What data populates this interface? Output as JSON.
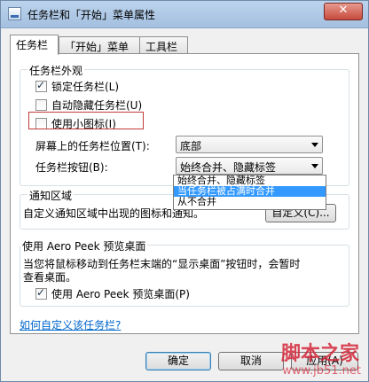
{
  "window": {
    "title": "任务栏和「开始」菜单属性",
    "close_label": "✕"
  },
  "tabs": [
    {
      "label": "任务栏",
      "active": true
    },
    {
      "label": "「开始」菜单",
      "active": false
    },
    {
      "label": "工具栏",
      "active": false
    }
  ],
  "appearance": {
    "legend": "任务栏外观",
    "lock_label": "锁定任务栏(L)",
    "autohide_label": "自动隐藏任务栏(U)",
    "small_icons_label": "使用小图标(I)",
    "position_label": "屏幕上的任务栏位置(T):",
    "position_value": "底部",
    "buttons_label": "任务栏按钮(B):",
    "buttons_value": "始终合并、隐藏标签",
    "buttons_options": [
      "始终合并、隐藏标签",
      "当任务栏被占满时合并",
      "从不合并"
    ]
  },
  "notification": {
    "legend": "通知区域",
    "description": "自定义通知区域中出现的图标和通知。",
    "customize_button": "自定义(C)..."
  },
  "aero": {
    "legend": "使用 Aero Peek 预览桌面",
    "description_line1": "当您将鼠标移动到任务栏末端的“显示桌面”按钮时，会暂时",
    "description_line2": "查看桌面。",
    "checkbox_label": "使用 Aero Peek 预览桌面(P)"
  },
  "help_link": "如何自定义该任务栏?",
  "buttons": {
    "ok": "确定",
    "cancel": "取消",
    "apply": "应用(A)"
  },
  "watermark": {
    "brand": "脚本之家",
    "url": "www.jb51.net"
  },
  "colors": {
    "selection": "#3399ff",
    "link": "#0066cc",
    "highlight_box": "#c23a3a",
    "watermark": "#d4283a"
  }
}
